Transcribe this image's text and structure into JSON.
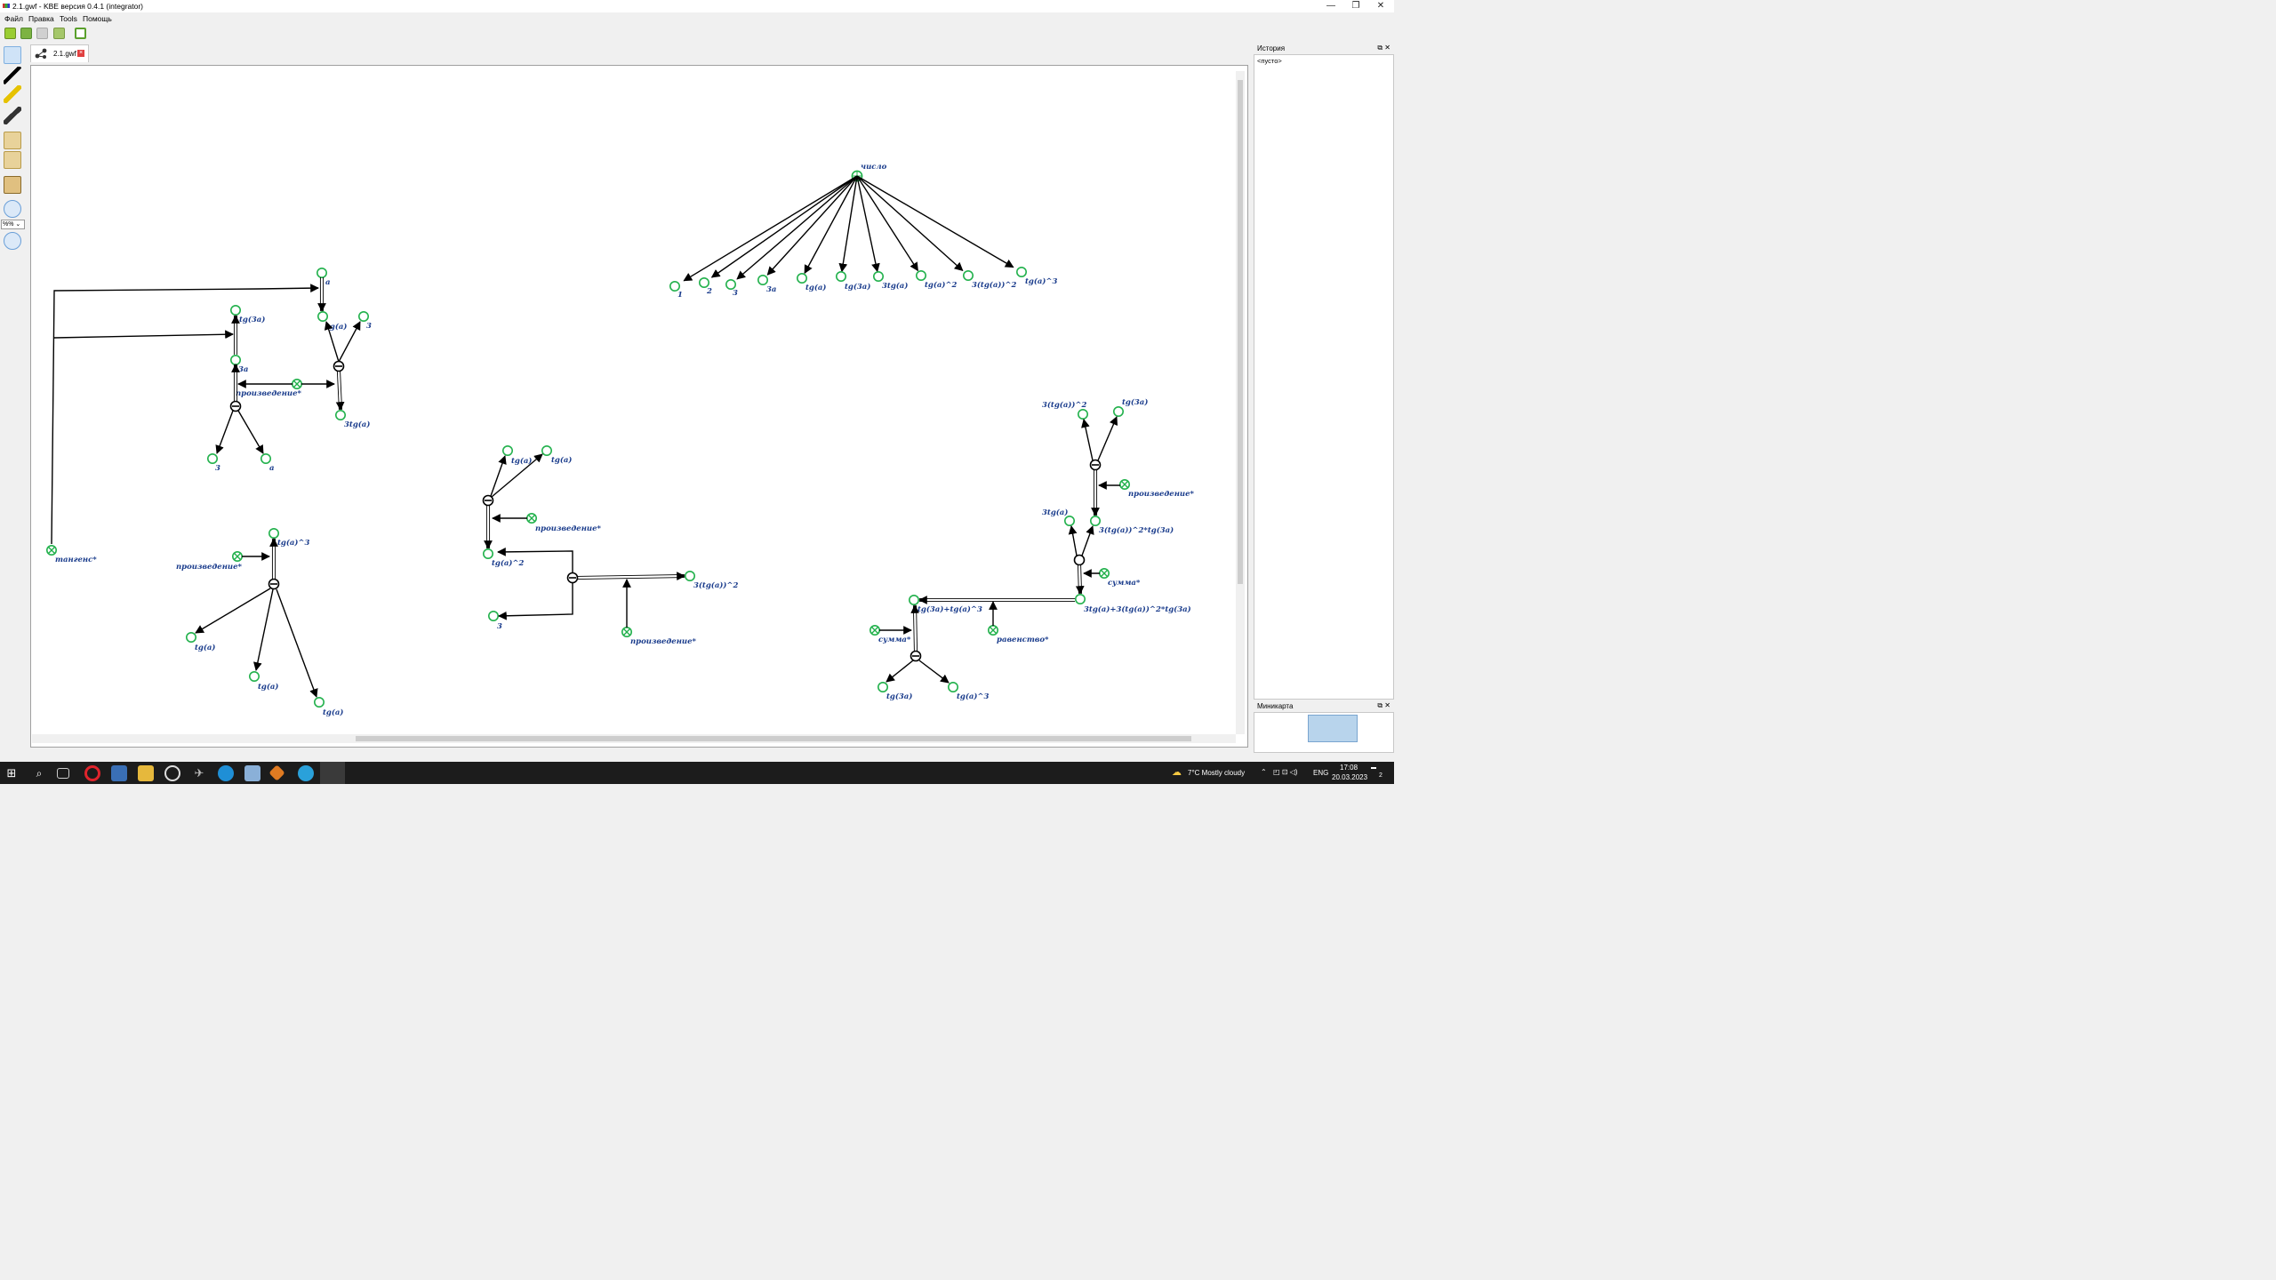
{
  "window": {
    "title": "2.1.gwf - KBE версия 0.4.1  (integrator)",
    "controls": {
      "minimize": "—",
      "maximize": "❐",
      "close": "✕"
    }
  },
  "menu": [
    "Файл",
    "Правка",
    "Tools",
    "Помощь"
  ],
  "zoom": {
    "value": "%%"
  },
  "tab": {
    "label": "2.1.gwf"
  },
  "panels": {
    "history": {
      "title": "История",
      "empty_item": "<пусто>"
    },
    "minimap": {
      "title": "Миникарта"
    }
  },
  "graph": {
    "labels": {
      "chislo": "число",
      "n1": "1",
      "n2": "2",
      "n3": "3",
      "n3a": "3a",
      "ntg": "tg(a)",
      "ntg3a": "tg(3a)",
      "n3tg": "3tg(a)",
      "ntg2": "tg(a)^2",
      "n3tg2": "3(tg(a))^2",
      "ntg3": "tg(a)^3",
      "tangens": "тангенс*",
      "a_top": "a",
      "tga_mid": "tg(a)",
      "three_mid": "3",
      "tg3a_left": "tg(3a)",
      "n3a_left": "3a",
      "proizv1": "произведение*",
      "three_tga1": "3tg(a)",
      "three_bl": "3",
      "a_bl": "a",
      "tga3_bot": "tg(a)^3",
      "proizv2": "произведение*",
      "tga_b1": "tg(a)",
      "tga_b2": "tg(a)",
      "tga_b3": "tg(a)",
      "tga_c1": "tg(a)",
      "tga_c2": "tg(a)",
      "proizv3": "произведение*",
      "tga2_c": "tg(a)^2",
      "three_c": "3",
      "three_tg2_c": "3(tg(a))^2",
      "proizv4": "произведение*",
      "r_3tg2": "3(tg(a))^2",
      "r_tg3a": "tg(3a)",
      "proizv5": "произведение*",
      "r_3tga": "3tg(a)",
      "r_prod": "3(tg(a))^2*tg(3a)",
      "summa1": "сумма*",
      "r_sum": "3tg(a)+3(tg(a))^2*tg(3a)",
      "l_sum": "tg(3a)+tg(a)^3",
      "summa2": "сумма*",
      "ravenstvo": "равенство*",
      "l_tg3a": "tg(3a)",
      "l_tga3": "tg(a)^3"
    }
  },
  "taskbar": {
    "weather": "7°C  Mostly cloudy",
    "lang": "ENG",
    "time": "17:08",
    "date": "20.03.2023",
    "notification_count": "2"
  },
  "colors": {
    "node": "#22b14c",
    "label": "#1a3c8c",
    "edge": "#000000"
  }
}
